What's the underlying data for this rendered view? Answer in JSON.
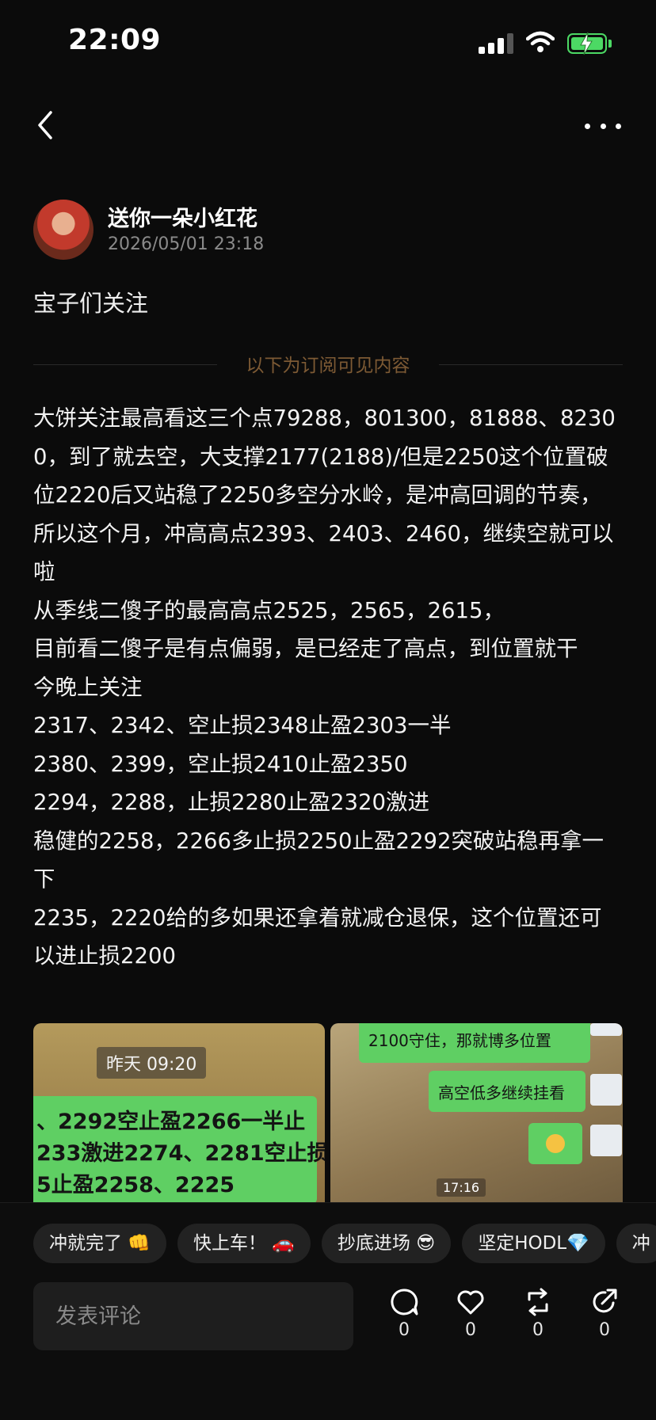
{
  "status_bar": {
    "time": "22:09"
  },
  "author": {
    "name": "送你一朵小红花",
    "timestamp": "2026/05/01 23:18"
  },
  "post": {
    "intro": "宝子们关注",
    "subscribe_divider": "以下为订阅可见内容",
    "lines": [
      "大饼关注最高看这三个点79288，801300，81888、82300，到了就去空，大支撑2177(2188)/但是2250这个位置破位2220后又站稳了2250多空分水岭，是冲高回调的节奏，所以这个月，冲高高点2393、2403、2460，继续空就可以啦",
      "从季线二傻子的最高高点2525，2565，2615，",
      "目前看二傻子是有点偏弱，是已经走了高点，到位置就干",
      "今晚上关注",
      "2317、2342、空止损2348止盈2303一半",
      "2380、2399，空止损2410止盈2350",
      "2294，2288，止损2280止盈2320激进",
      "稳健的2258，2266多止损2250止盈2292突破站稳再拿一下",
      "2235，2220给的多如果还拿着就减仓退保，这个位置还可以进止损2200"
    ]
  },
  "images": {
    "img1": {
      "timestamp": "昨天 09:20",
      "line1": "、2292空止盈2266一半止",
      "line2": "233激进2274、2281空止损",
      "line3": "5止盈2258、2225"
    },
    "img2": {
      "bubble1": "2100守住，那就博多位置",
      "bubble2": "高空低多继续挂看",
      "time": "17:16"
    }
  },
  "reactions": [
    "冲就完了 👊",
    "快上车！ 🚗",
    "抄底进场 😎",
    "坚定HODL💎",
    "冲"
  ],
  "comment": {
    "placeholder": "发表评论"
  },
  "actions": {
    "comments": "0",
    "likes": "0",
    "reposts": "0",
    "shares": "0"
  }
}
